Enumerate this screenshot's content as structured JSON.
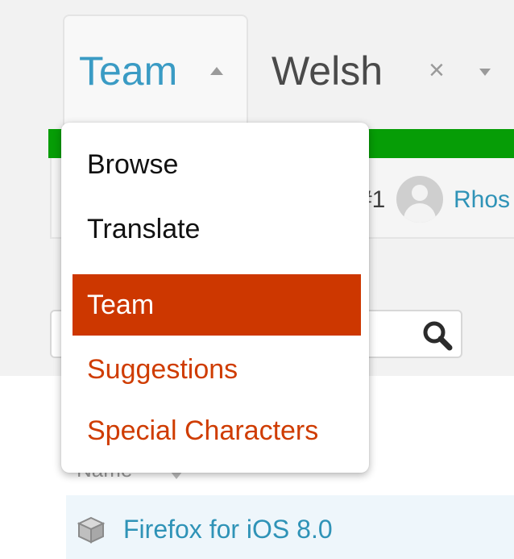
{
  "header": {
    "context": "Team",
    "locale": "Welsh",
    "locale_close_glyph": "×"
  },
  "progress": {
    "percent": 100,
    "color": "#069d06"
  },
  "top_contributor": {
    "rank_fragment": "#1",
    "user_fragment": "Rhos"
  },
  "search": {
    "placeholder": "",
    "icon": "search-icon"
  },
  "table": {
    "header_name": "Name",
    "rows": [
      {
        "name": "Firefox for iOS 8.0",
        "icon": "package-icon"
      }
    ]
  },
  "menu": {
    "items": [
      {
        "label": "Browse"
      },
      {
        "label": "Translate"
      },
      {
        "label": "Team",
        "active": true
      },
      {
        "label": "Suggestions"
      },
      {
        "label": "Special Characters"
      }
    ],
    "accent_color": "#cd3700"
  }
}
